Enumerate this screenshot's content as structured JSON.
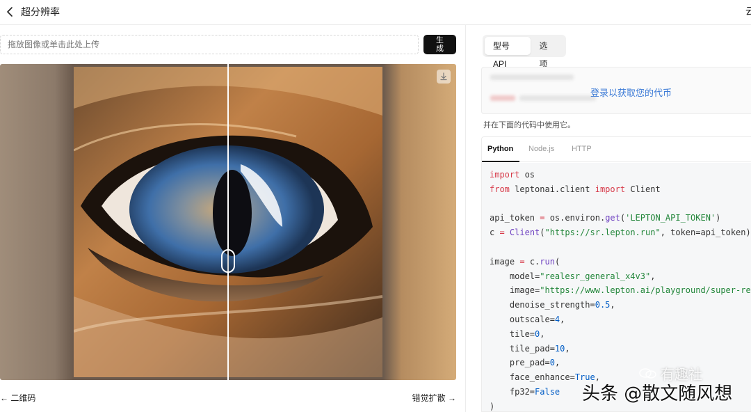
{
  "header": {
    "title": "超分辨率",
    "right_text": "云"
  },
  "upload": {
    "placeholder": "拖放图像或单击此处上传",
    "generate_label": "生成"
  },
  "nav": {
    "prev_label": "← 二维码",
    "next_label": "错觉扩散 →"
  },
  "right": {
    "segment_tabs": [
      {
        "label": "型号API",
        "active": true
      },
      {
        "label": "选项",
        "active": false
      }
    ],
    "login_link": "登录以获取您的代币",
    "token_hint": "并在下面的代码中使用它。",
    "code_tabs": [
      {
        "label": "Python",
        "active": true
      },
      {
        "label": "Node.js",
        "active": false
      },
      {
        "label": "HTTP",
        "active": false
      }
    ]
  },
  "code_lines": [
    [
      {
        "t": "import",
        "c": "kw"
      },
      {
        "t": " os",
        "c": ""
      }
    ],
    [
      {
        "t": "from",
        "c": "kw"
      },
      {
        "t": " leptonai.client ",
        "c": ""
      },
      {
        "t": "import",
        "c": "kw"
      },
      {
        "t": " Client",
        "c": ""
      }
    ],
    [
      {
        "t": "",
        "c": ""
      }
    ],
    [
      {
        "t": "api_token ",
        "c": ""
      },
      {
        "t": "=",
        "c": "op"
      },
      {
        "t": " os.environ.",
        "c": ""
      },
      {
        "t": "get",
        "c": "fn"
      },
      {
        "t": "(",
        "c": ""
      },
      {
        "t": "'LEPTON_API_TOKEN'",
        "c": "st"
      },
      {
        "t": ")",
        "c": ""
      }
    ],
    [
      {
        "t": "c ",
        "c": ""
      },
      {
        "t": "=",
        "c": "op"
      },
      {
        "t": " ",
        "c": ""
      },
      {
        "t": "Client",
        "c": "fn"
      },
      {
        "t": "(",
        "c": ""
      },
      {
        "t": "\"https://sr.lepton.run\"",
        "c": "st"
      },
      {
        "t": ", token=api_token)",
        "c": ""
      }
    ],
    [
      {
        "t": "",
        "c": ""
      }
    ],
    [
      {
        "t": "image ",
        "c": ""
      },
      {
        "t": "=",
        "c": "op"
      },
      {
        "t": " c.",
        "c": ""
      },
      {
        "t": "run",
        "c": "fn"
      },
      {
        "t": "(",
        "c": ""
      }
    ],
    [
      {
        "t": "    model=",
        "c": ""
      },
      {
        "t": "\"realesr_general_x4v3\"",
        "c": "st"
      },
      {
        "t": ",",
        "c": ""
      }
    ],
    [
      {
        "t": "    image=",
        "c": ""
      },
      {
        "t": "\"https://www.lepton.ai/playground/super-resolu",
        "c": "st"
      }
    ],
    [
      {
        "t": "    denoise_strength=",
        "c": ""
      },
      {
        "t": "0.5",
        "c": "nb"
      },
      {
        "t": ",",
        "c": ""
      }
    ],
    [
      {
        "t": "    outscale=",
        "c": ""
      },
      {
        "t": "4",
        "c": "nb"
      },
      {
        "t": ",",
        "c": ""
      }
    ],
    [
      {
        "t": "    tile=",
        "c": ""
      },
      {
        "t": "0",
        "c": "nb"
      },
      {
        "t": ",",
        "c": ""
      }
    ],
    [
      {
        "t": "    tile_pad=",
        "c": ""
      },
      {
        "t": "10",
        "c": "nb"
      },
      {
        "t": ",",
        "c": ""
      }
    ],
    [
      {
        "t": "    pre_pad=",
        "c": ""
      },
      {
        "t": "0",
        "c": "nb"
      },
      {
        "t": ",",
        "c": ""
      }
    ],
    [
      {
        "t": "    face_enhance=",
        "c": ""
      },
      {
        "t": "True",
        "c": "nb"
      },
      {
        "t": ",",
        "c": ""
      }
    ],
    [
      {
        "t": "    fp32=",
        "c": ""
      },
      {
        "t": "False",
        "c": "nb"
      }
    ],
    [
      {
        "t": ")",
        "c": ""
      }
    ]
  ],
  "watermark": {
    "main": "头条 @散文随风想",
    "secondary": "有趣社"
  },
  "colors": {
    "accent_link": "#3b7ad6",
    "button_dark": "#111111",
    "border": "#ececec"
  }
}
